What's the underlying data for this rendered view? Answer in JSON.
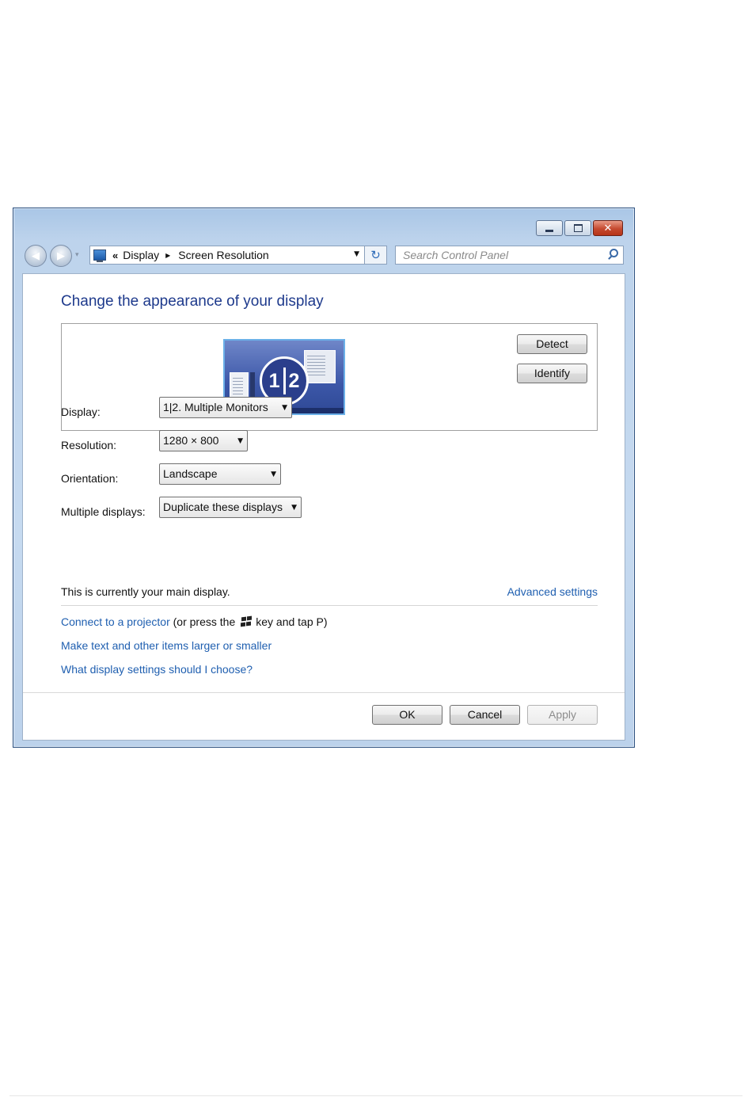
{
  "window": {
    "caption_buttons": [
      "minimize-icon",
      "maximize-icon",
      "close-icon"
    ],
    "close_glyph": "✕"
  },
  "nav": {
    "back_glyph": "◀",
    "forward_glyph": "▶",
    "history_glyph": "▾",
    "address": {
      "overflow": "«",
      "crumbs": [
        "Display",
        "Screen Resolution"
      ],
      "crumb_separator": "▶",
      "dropdown_glyph": "▼"
    },
    "refresh_glyph": "↻",
    "search_placeholder": "Search Control Panel"
  },
  "main": {
    "heading": "Change the appearance of your display",
    "preview": {
      "badge_left": "1",
      "badge_right": "2"
    },
    "detect_label": "Detect",
    "identify_label": "Identify",
    "settings": [
      {
        "label": "Display:",
        "value": "1|2. Multiple Monitors"
      },
      {
        "label": "Resolution:",
        "value": "1280 × 800"
      },
      {
        "label": "Orientation:",
        "value": "Landscape"
      },
      {
        "label": "Multiple displays:",
        "value": "Duplicate these displays"
      }
    ],
    "combo_arrow": "▼",
    "status": "This is currently your main display.",
    "advanced_link": "Advanced settings",
    "projector_link": "Connect to a projector",
    "projector_hint_pre": "(or press the",
    "projector_hint_post": "key and tap P)",
    "text_size_link": "Make text and other items larger or smaller",
    "help_link": "What display settings should I choose?"
  },
  "footer": {
    "ok_label": "OK",
    "cancel_label": "Cancel",
    "apply_label": "Apply"
  },
  "colors": {
    "link": "#1f5fb0",
    "heading": "#1e3a8c",
    "close_button": "#c54a30"
  }
}
